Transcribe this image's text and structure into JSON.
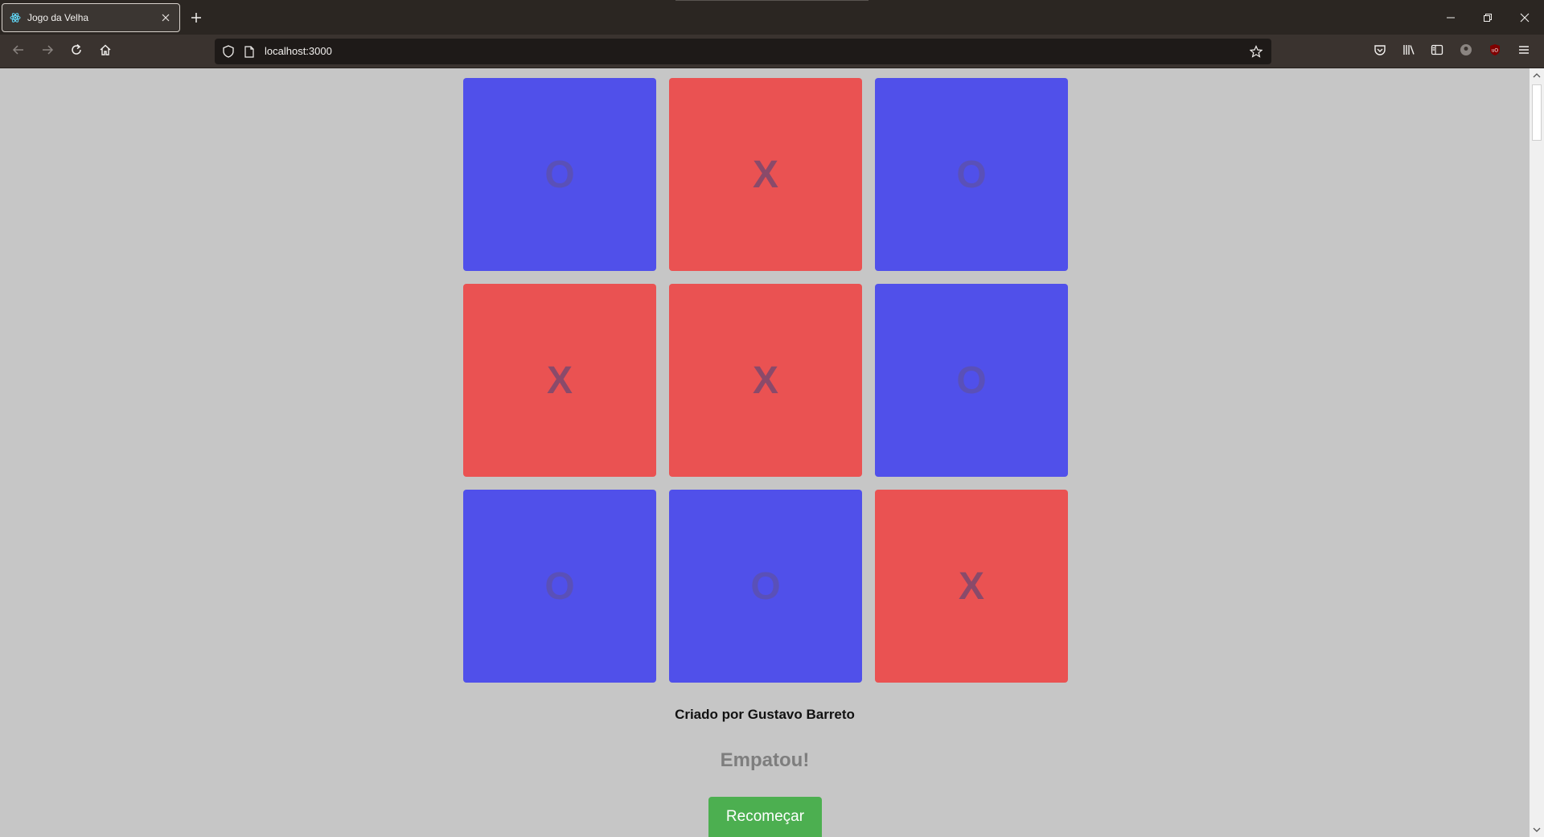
{
  "browser": {
    "tab": {
      "title": "Jogo da Velha",
      "favicon": "react-icon"
    },
    "url": "localhost:3000"
  },
  "game": {
    "colors": {
      "X": "#ea5252",
      "O": "#5050ea",
      "X_text": "#8a4a6a",
      "O_text": "#5a50b8"
    },
    "board": [
      [
        "O",
        "X",
        "O"
      ],
      [
        "X",
        "X",
        "O"
      ],
      [
        "O",
        "O",
        "X"
      ]
    ],
    "credit": "Criado por Gustavo Barreto",
    "status": "Empatou!",
    "restart_label": "Recomeçar"
  }
}
